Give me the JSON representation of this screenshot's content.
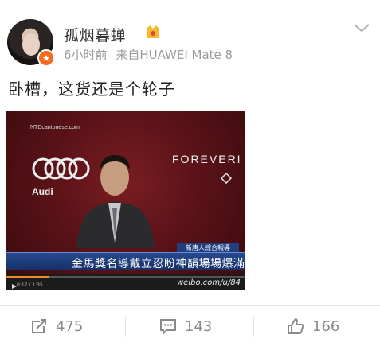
{
  "user": {
    "name": "孤烟暮蝉",
    "time": "6小时前",
    "source": "来自HUAWEI Mate 8"
  },
  "post": {
    "text": "卧槽，这货还是个轮子"
  },
  "media": {
    "channel_logo": "NTDcantonese.com",
    "logo_text": "Audi",
    "brand_text": "FOREVERI",
    "caption_top": "新唐人綜合報導",
    "caption": "金馬獎名導戴立忍盼神韻場場爆滿",
    "time": "0:17 / 1:35",
    "progress": 0.18,
    "watermark": "weibo.com/u/84"
  },
  "actions": {
    "repost": "475",
    "comment": "143",
    "like": "166"
  },
  "colors": {
    "accent_orange": "#f56a1f",
    "caption_blue": "#1f3f7f"
  }
}
